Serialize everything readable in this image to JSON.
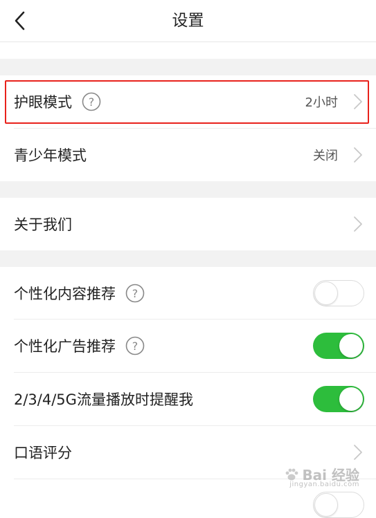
{
  "header": {
    "title": "设置"
  },
  "rows": {
    "eye_mode": {
      "label": "护眼模式",
      "value": "2小时"
    },
    "teen_mode": {
      "label": "青少年模式",
      "value": "关闭"
    },
    "about": {
      "label": "关于我们"
    },
    "personalized_content": {
      "label": "个性化内容推荐",
      "enabled": false
    },
    "personalized_ads": {
      "label": "个性化广告推荐",
      "enabled": true
    },
    "mobile_data_alert": {
      "label": "2/3/4/5G流量播放时提醒我",
      "enabled": true
    },
    "oral_scoring": {
      "label": "口语评分"
    }
  },
  "colors": {
    "toggle_on": "#2dbd3c",
    "highlight_border": "#e8211b",
    "section_gap": "#f2f2f2"
  },
  "watermark": {
    "text": "Bai 经验",
    "subtext": "jingyan.baidu.com"
  }
}
